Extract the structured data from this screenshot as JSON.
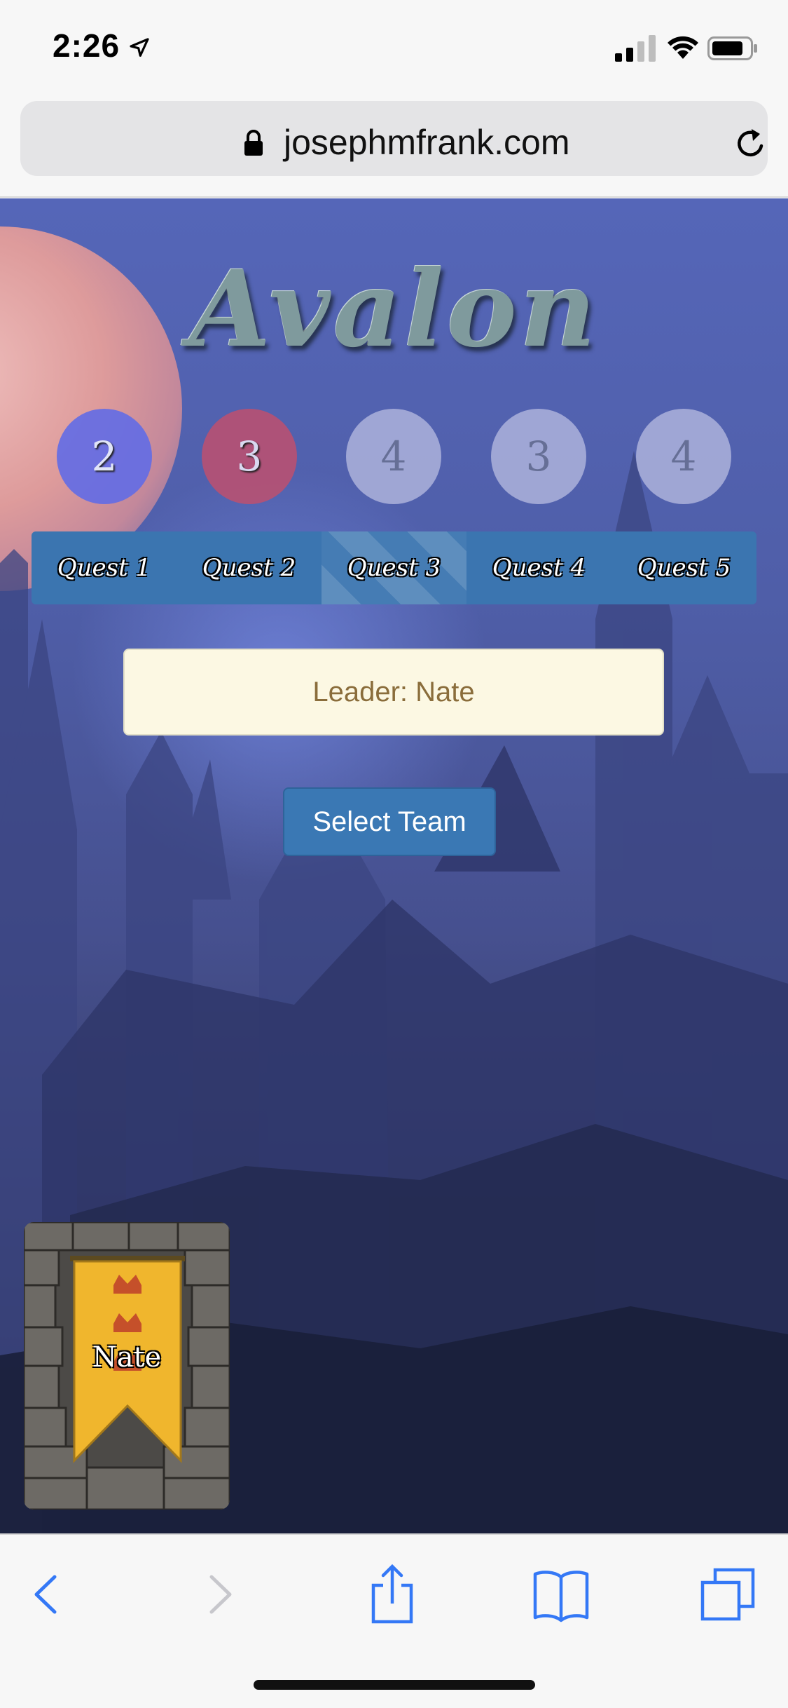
{
  "status_bar": {
    "time": "2:26",
    "icons": [
      "location-arrow-icon",
      "signal-icon",
      "wifi-icon",
      "battery-icon"
    ]
  },
  "browser": {
    "url": "josephmfrank.com",
    "icons": [
      "lock-icon",
      "reload-icon"
    ]
  },
  "game": {
    "title": "Avalon",
    "quest_sizes": [
      {
        "value": "2",
        "state": "success"
      },
      {
        "value": "3",
        "state": "fail"
      },
      {
        "value": "4",
        "state": "pending"
      },
      {
        "value": "3",
        "state": "pending"
      },
      {
        "value": "4",
        "state": "pending"
      }
    ],
    "quest_tabs": [
      "Quest 1",
      "Quest 2",
      "Quest 3",
      "Quest 4",
      "Quest 5"
    ],
    "active_quest": "Quest 3",
    "leader_text": "Leader: Nate",
    "select_team_label": "Select Team",
    "player_card": {
      "name": "Nate"
    }
  },
  "colors": {
    "success": "#626ce6",
    "fail": "#be506e",
    "pending": "#b9bee1",
    "quest_bar": "#3b75b0",
    "leader_bg": "#fcf8e3",
    "leader_text": "#8a6d3b",
    "button": "#3a78b4",
    "ios_blue": "#3478f6"
  },
  "toolbar": {
    "icons": [
      "back-icon",
      "forward-icon",
      "share-icon",
      "bookmarks-icon",
      "tabs-icon"
    ]
  }
}
